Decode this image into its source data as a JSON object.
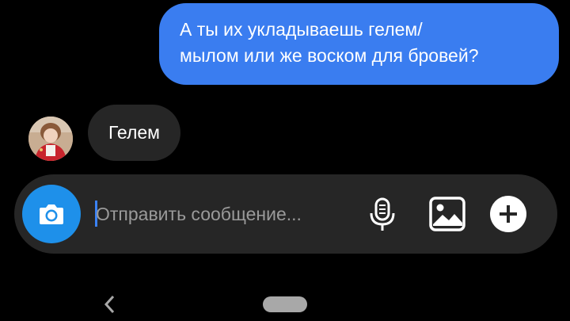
{
  "conversation": {
    "messages": [
      {
        "direction": "outgoing",
        "text": "А ты их укладываешь гелем/\nмылом или же воском для бровей?"
      },
      {
        "direction": "incoming",
        "text": "Гелем"
      }
    ]
  },
  "composer": {
    "placeholder": "Отправить сообщение...",
    "accent_color": "#1e90ea",
    "icons": [
      "camera-icon",
      "microphone-icon",
      "gallery-icon",
      "plus-icon"
    ]
  },
  "colors": {
    "outgoing_bubble": "#3a7df0",
    "incoming_bubble": "#262626",
    "background": "#000000"
  },
  "navigation": {
    "icons": [
      "back-icon",
      "home-pill"
    ]
  }
}
